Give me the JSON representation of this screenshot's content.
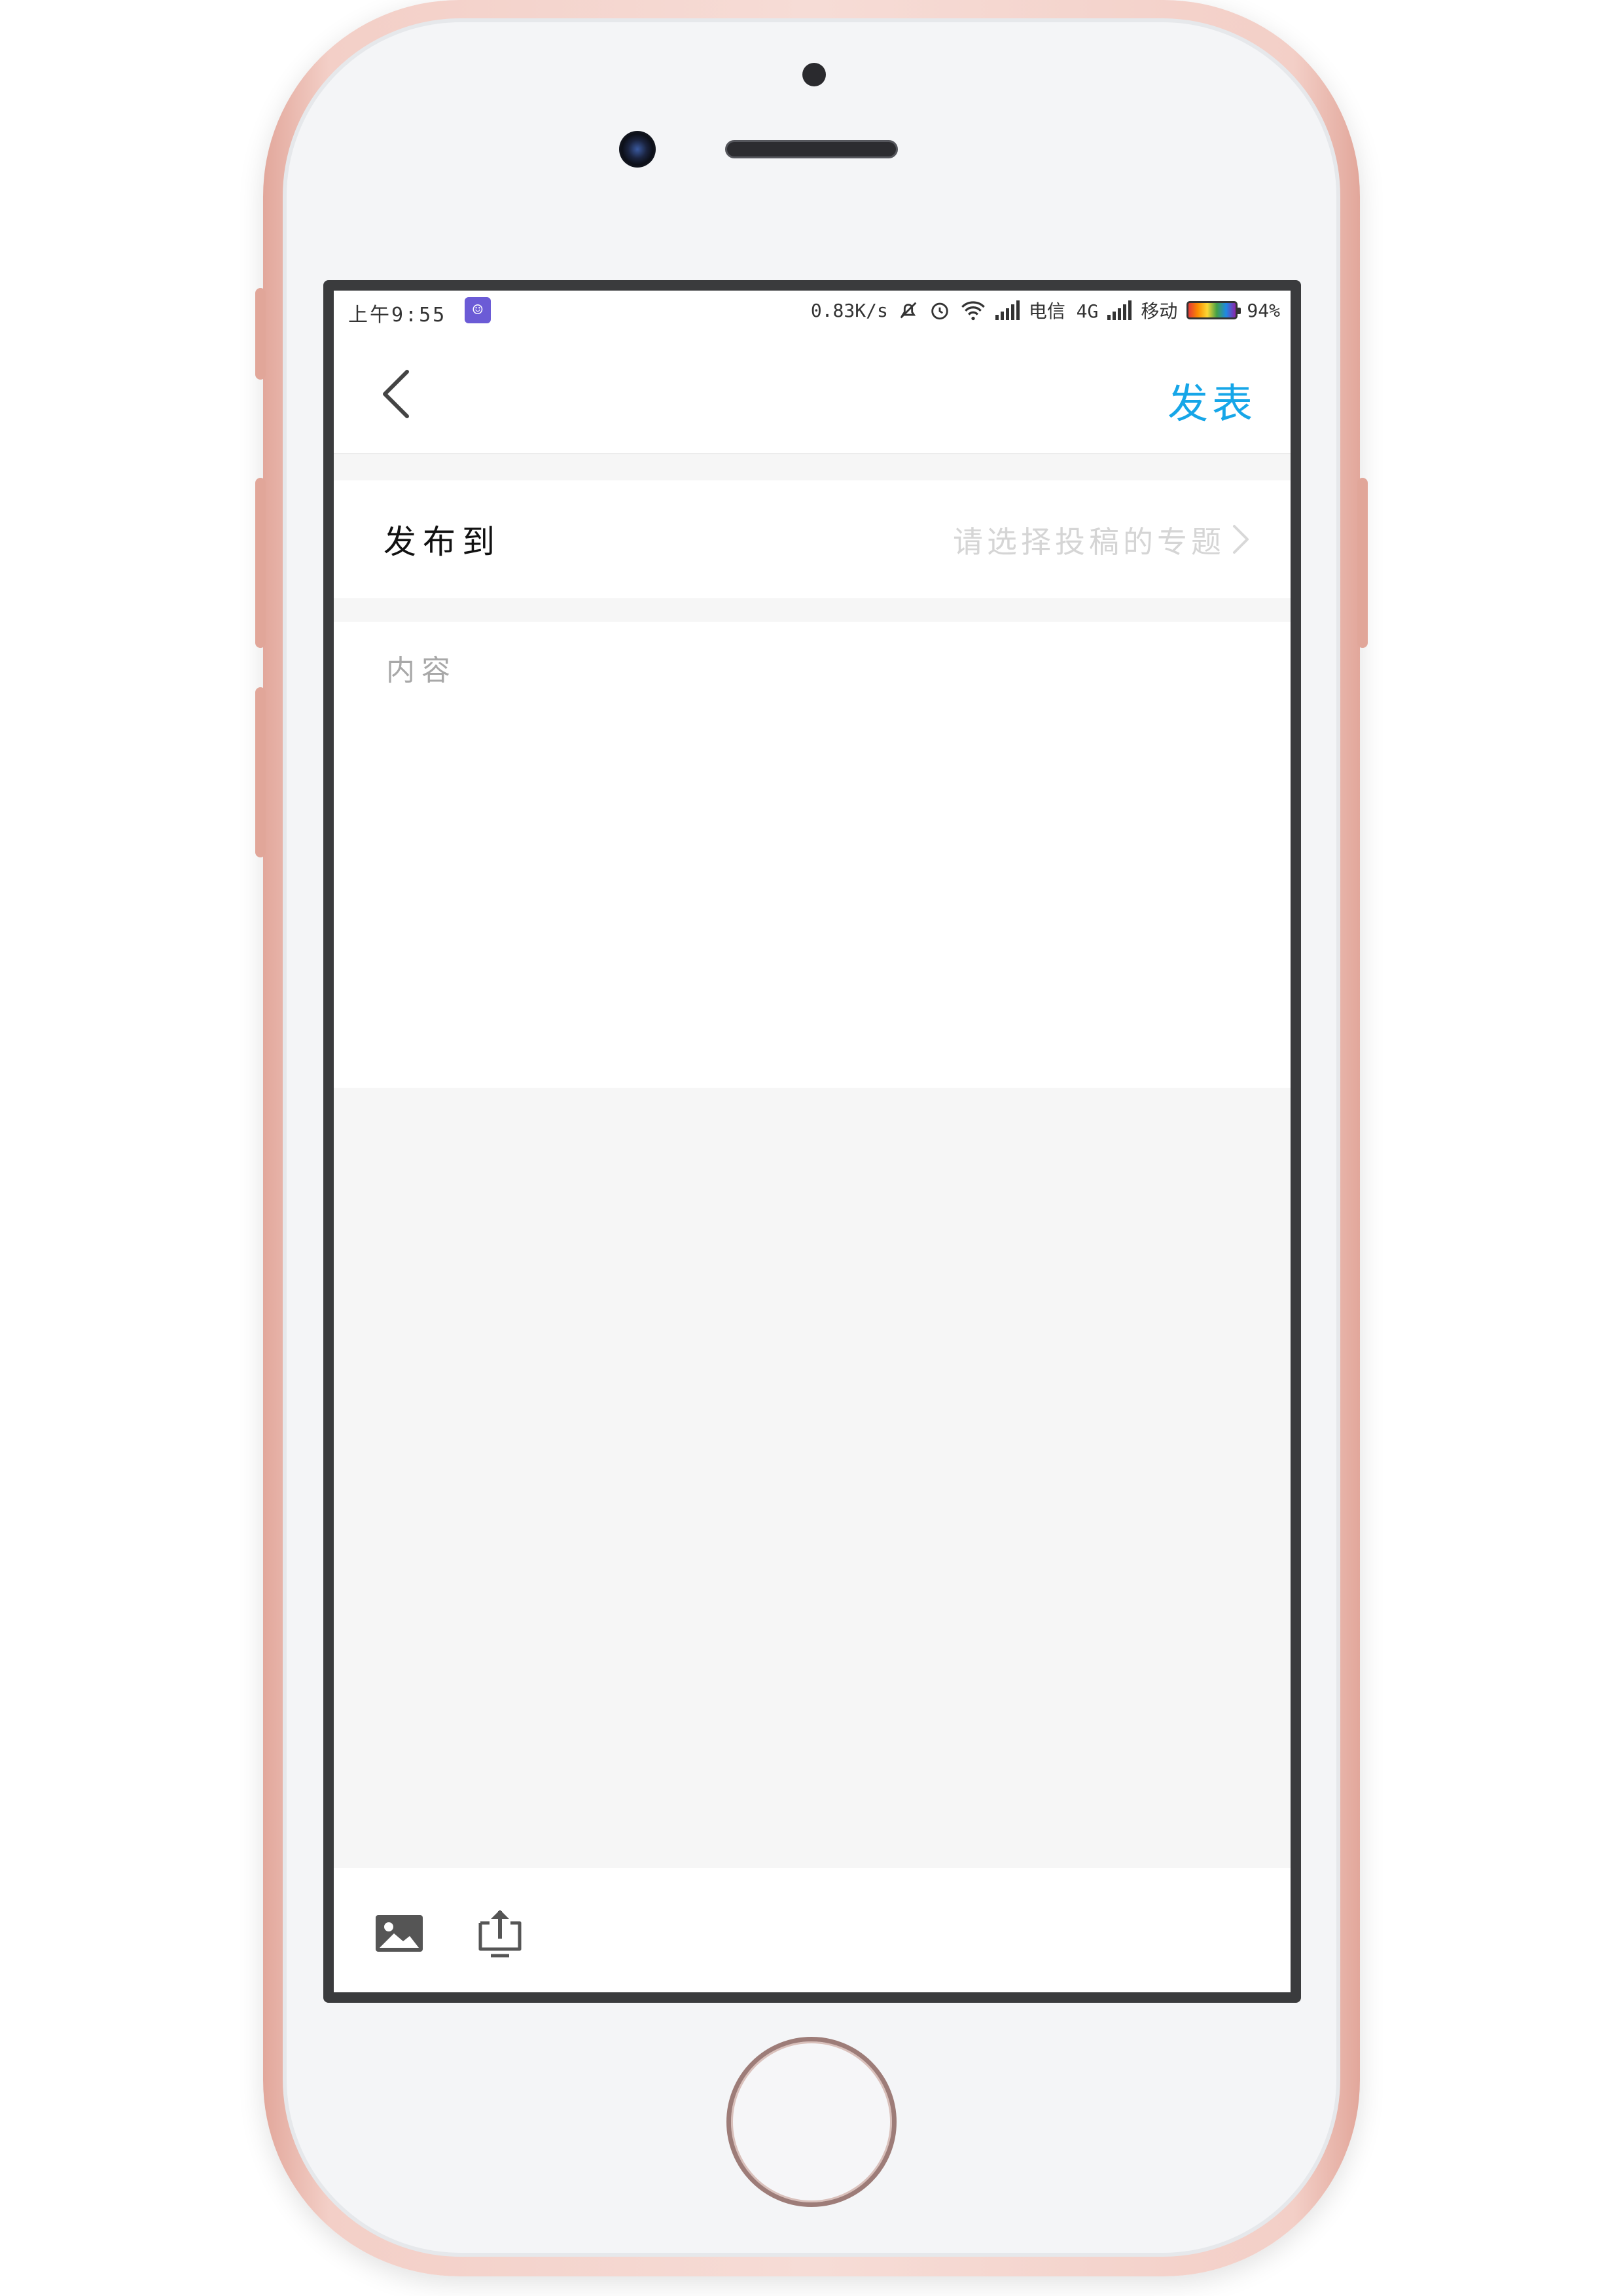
{
  "status_bar": {
    "time": "上午9:55",
    "net_speed": "0.83K/s",
    "carrier1": "电信 4G",
    "carrier2": "移动",
    "battery": "94%"
  },
  "nav": {
    "publish_label": "发表"
  },
  "publish_to": {
    "label": "发布到",
    "placeholder": "请选择投稿的专题"
  },
  "content": {
    "placeholder": "内容"
  },
  "icons": {
    "back": "chevron-left-icon",
    "image": "image-icon",
    "upload": "upload-icon",
    "mute": "bell-off-icon",
    "alarm": "alarm-icon",
    "wifi": "wifi-icon"
  },
  "colors": {
    "accent": "#16a6e8",
    "app_badge": "#6b5bd6"
  }
}
